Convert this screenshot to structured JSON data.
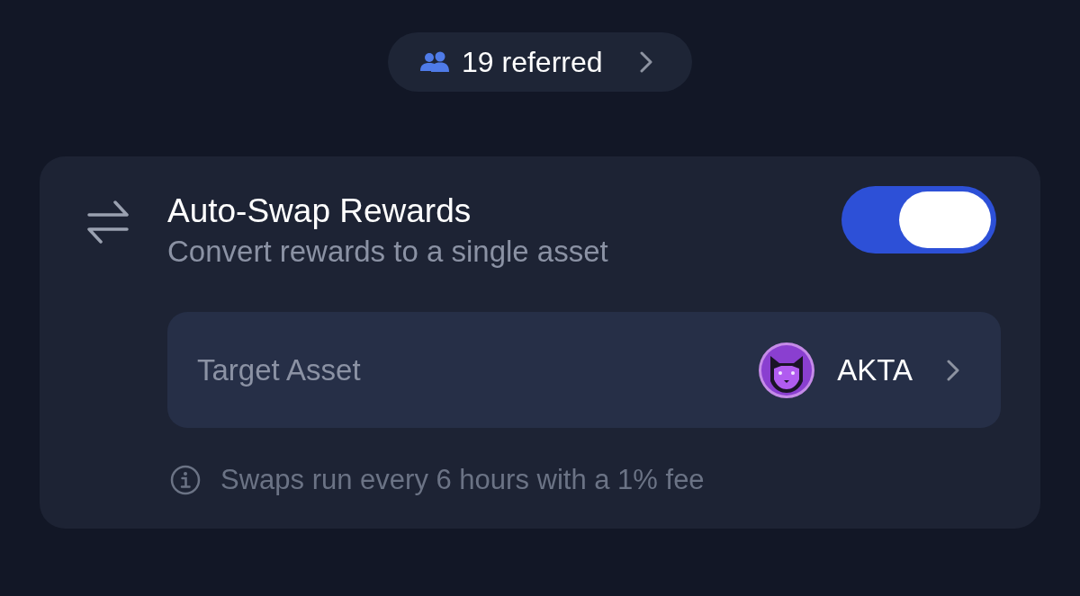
{
  "referral_pill": {
    "label": "19 referred"
  },
  "auto_swap": {
    "title": "Auto-Swap Rewards",
    "subtitle": "Convert rewards to a single asset",
    "on": true,
    "target_asset": {
      "label": "Target Asset",
      "value": "AKTA"
    },
    "note": "Swaps run every 6 hours with a 1% fee"
  }
}
